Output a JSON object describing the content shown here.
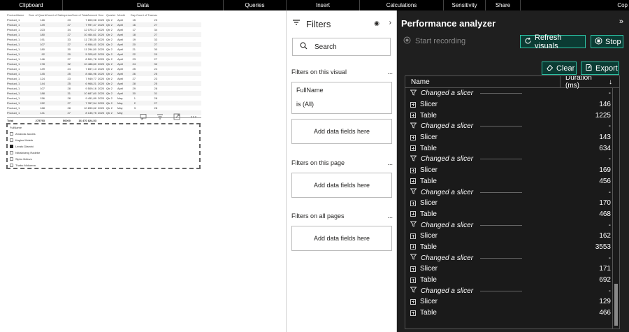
{
  "ribbon": {
    "groups": [
      "Clipboard",
      "Data",
      "Queries",
      "Insert",
      "Calculations",
      "Sensitivity",
      "Share",
      "Cop"
    ]
  },
  "table": {
    "headers": [
      "ProductName",
      "Sum of Quantity",
      "Count of SalespersonID",
      "Sum of TotalAmount",
      "Year",
      "Quarter",
      "Month",
      "Day",
      "Count of TransactionID"
    ],
    "rows": [
      [
        "Product_1",
        "116",
        "23",
        "7 800,08",
        "2025",
        "Qtr 2",
        "April",
        "15",
        "23"
      ],
      [
        "Product_1",
        "149",
        "27",
        "7 997,47",
        "2025",
        "Qtr 2",
        "April",
        "16",
        "27"
      ],
      [
        "Product_1",
        "223",
        "34",
        "12 075,17",
        "2025",
        "Qtr 2",
        "April",
        "17",
        "34"
      ],
      [
        "Product_1",
        "180",
        "27",
        "10 464,61",
        "2025",
        "Qtr 2",
        "April",
        "18",
        "27"
      ],
      [
        "Product_1",
        "191",
        "33",
        "11 735,35",
        "2025",
        "Qtr 2",
        "April",
        "19",
        "33"
      ],
      [
        "Product_1",
        "107",
        "27",
        "6 956,41",
        "2025",
        "Qtr 2",
        "April",
        "20",
        "27"
      ],
      [
        "Product_1",
        "180",
        "30",
        "11 294,50",
        "2025",
        "Qtr 2",
        "April",
        "21",
        "30"
      ],
      [
        "Product_1",
        "92",
        "20",
        "5 325,62",
        "2025",
        "Qtr 2",
        "April",
        "22",
        "20"
      ],
      [
        "Product_1",
        "146",
        "27",
        "8 501,78",
        "2025",
        "Qtr 2",
        "April",
        "23",
        "27"
      ],
      [
        "Product_1",
        "178",
        "32",
        "10 488,60",
        "2025",
        "Qtr 2",
        "April",
        "24",
        "32"
      ],
      [
        "Product_1",
        "149",
        "24",
        "7 657,13",
        "2025",
        "Qtr 2",
        "April",
        "25",
        "24"
      ],
      [
        "Product_1",
        "145",
        "25",
        "8 464,96",
        "2025",
        "Qtr 2",
        "April",
        "26",
        "25"
      ],
      [
        "Product_1",
        "124",
        "23",
        "7 949,77",
        "2025",
        "Qtr 2",
        "April",
        "27",
        "23"
      ],
      [
        "Product_1",
        "144",
        "25",
        "6 968,21",
        "2025",
        "Qtr 2",
        "April",
        "28",
        "25"
      ],
      [
        "Product_1",
        "107",
        "28",
        "9 509,16",
        "2025",
        "Qtr 2",
        "April",
        "29",
        "28"
      ],
      [
        "Product_1",
        "188",
        "31",
        "10 687,60",
        "2025",
        "Qtr 2",
        "April",
        "30",
        "31"
      ],
      [
        "Product_1",
        "156",
        "28",
        "9 451,89",
        "2025",
        "Qtr 2",
        "May",
        "1",
        "28"
      ],
      [
        "Product_1",
        "152",
        "27",
        "7 357,54",
        "2025",
        "Qtr 2",
        "May",
        "2",
        "27"
      ],
      [
        "Product_1",
        "168",
        "28",
        "10 890,62",
        "2025",
        "Qtr 2",
        "May",
        "3",
        "28"
      ],
      [
        "Product_1",
        "141",
        "27",
        "8 135,75",
        "2025",
        "Qtr 2",
        "May",
        "",
        ""
      ]
    ],
    "total": [
      "Total",
      "275793",
      "50000",
      "16 470 824,53",
      "",
      "",
      "",
      "",
      ""
    ]
  },
  "slicer": {
    "title": "FullName",
    "items": [
      {
        "label": "Amanda Jacobs",
        "checked": false
      },
      {
        "label": "Kagiso Molefe",
        "checked": false
      },
      {
        "label": "Lerato Dlamini",
        "checked": true
      },
      {
        "label": "Nthabiseng Radebe",
        "checked": false
      },
      {
        "label": "Sipho Ndlovu",
        "checked": false
      },
      {
        "label": "Thabo Mokoena",
        "checked": false
      }
    ]
  },
  "filters": {
    "title": "Filters",
    "search_placeholder": "Search",
    "on_visual_label": "Filters on this visual",
    "on_page_label": "Filters on this page",
    "on_all_pages_label": "Filters on all pages",
    "more": "...",
    "field_name": "FullName",
    "field_value": "is (All)",
    "add_fields_label": "Add data fields here"
  },
  "perf": {
    "title": "Performance analyzer",
    "start_recording": "Start recording",
    "refresh_visuals": "Refresh visuals",
    "stop": "Stop",
    "clear": "Clear",
    "export": "Export",
    "col_name": "Name",
    "col_duration": "Duration (ms)",
    "rows": [
      {
        "type": "action",
        "label": "Changed a slicer",
        "duration": "-"
      },
      {
        "type": "visual",
        "label": "Slicer",
        "duration": "146"
      },
      {
        "type": "visual",
        "label": "Table",
        "duration": "1225"
      },
      {
        "type": "action",
        "label": "Changed a slicer",
        "duration": "-"
      },
      {
        "type": "visual",
        "label": "Slicer",
        "duration": "143"
      },
      {
        "type": "visual",
        "label": "Table",
        "duration": "634"
      },
      {
        "type": "action",
        "label": "Changed a slicer",
        "duration": "-"
      },
      {
        "type": "visual",
        "label": "Slicer",
        "duration": "169"
      },
      {
        "type": "visual",
        "label": "Table",
        "duration": "456"
      },
      {
        "type": "action",
        "label": "Changed a slicer",
        "duration": "-"
      },
      {
        "type": "visual",
        "label": "Slicer",
        "duration": "170"
      },
      {
        "type": "visual",
        "label": "Table",
        "duration": "468"
      },
      {
        "type": "action",
        "label": "Changed a slicer",
        "duration": "-"
      },
      {
        "type": "visual",
        "label": "Slicer",
        "duration": "162"
      },
      {
        "type": "visual",
        "label": "Table",
        "duration": "3553"
      },
      {
        "type": "action",
        "label": "Changed a slicer",
        "duration": "-"
      },
      {
        "type": "visual",
        "label": "Slicer",
        "duration": "171"
      },
      {
        "type": "visual",
        "label": "Table",
        "duration": "692"
      },
      {
        "type": "action",
        "label": "Changed a slicer",
        "duration": "-"
      },
      {
        "type": "visual",
        "label": "Slicer",
        "duration": "129"
      },
      {
        "type": "visual",
        "label": "Table",
        "duration": "466"
      }
    ]
  },
  "colors": {
    "accent": "#2ec4a6",
    "panel_bg": "#1f1f1f",
    "ribbon_bg": "#000000"
  }
}
